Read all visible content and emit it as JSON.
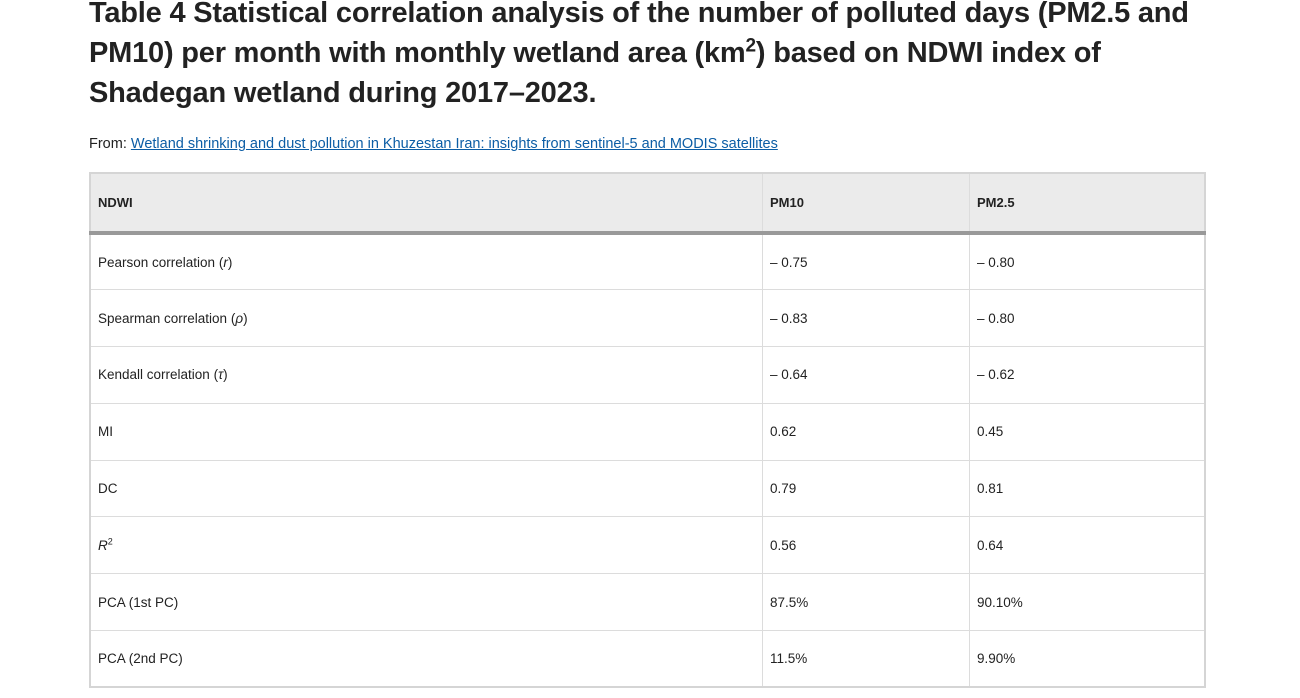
{
  "page": {
    "title_part1": "Table 4 Statistical correlation analysis of the number of polluted days (PM2.5 and PM10) per month with monthly wetland area (km",
    "title_sup": "2",
    "title_part2": ") based on NDWI index of Shadegan wetland during 2017–2023.",
    "from_label": "From:",
    "source_link": "Wetland shrinking and dust pollution in Khuzestan Iran: insights from sentinel-5 and MODIS satellites"
  },
  "table": {
    "headers": [
      "NDWI",
      "PM10",
      "PM2.5"
    ],
    "rows": [
      {
        "label": "Pearson correlation (",
        "sym": "r",
        "suffix": ")",
        "pm10": "– 0.75",
        "pm25": "– 0.80"
      },
      {
        "label": "Spearman correlation (",
        "sym": "ρ",
        "suffix": ")",
        "pm10": "– 0.83",
        "pm25": "– 0.80"
      },
      {
        "label": "Kendall correlation (",
        "sym": "τ",
        "suffix": ")",
        "pm10": "– 0.64",
        "pm25": "– 0.62"
      },
      {
        "label": "MI",
        "sym": "",
        "suffix": "",
        "pm10": "0.62",
        "pm25": "0.45"
      },
      {
        "label": "DC",
        "sym": "",
        "suffix": "",
        "pm10": "0.79",
        "pm25": "0.81"
      },
      {
        "label": "",
        "sym": "R",
        "sup": "2",
        "suffix": "",
        "pm10": "0.56",
        "pm25": "0.64"
      },
      {
        "label": "PCA (1st PC)",
        "sym": "",
        "suffix": "",
        "pm10": "87.5%",
        "pm25": "90.10%"
      },
      {
        "label": "PCA (2nd PC)",
        "sym": "",
        "suffix": "",
        "pm10": "11.5%",
        "pm25": "9.90%"
      }
    ]
  }
}
